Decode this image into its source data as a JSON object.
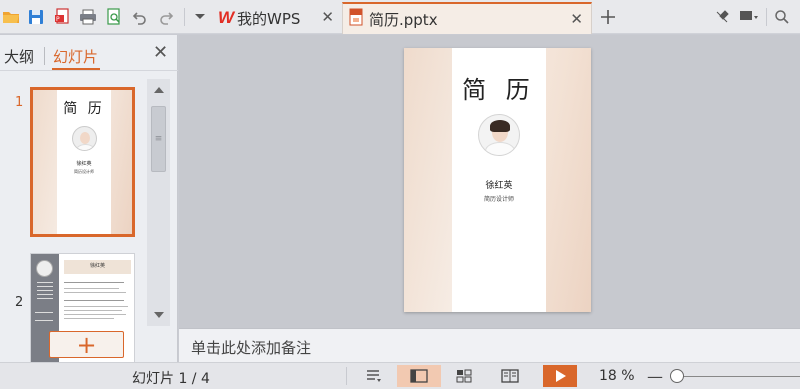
{
  "tabs": {
    "home_label": "我的WPS",
    "doc_label": "简历.pptx",
    "close_glyph": "✕"
  },
  "left_panel": {
    "outline_tab": "大纲",
    "slides_tab": "幻灯片",
    "close_glyph": "✕",
    "slide_numbers": [
      "1",
      "2"
    ],
    "add_label": "+"
  },
  "slide": {
    "title": "简 历",
    "name": "徐红英",
    "subtitle": "简历设计师"
  },
  "thumb2": {
    "header_name": "徐红英"
  },
  "notes": {
    "placeholder": "单击此处添加备注"
  },
  "status": {
    "slide_counter": "幻灯片 1 / 4",
    "zoom": "18 %",
    "zoom_minus": "—"
  },
  "colors": {
    "accent": "#d9672b",
    "wps_red": "#e22d24"
  }
}
